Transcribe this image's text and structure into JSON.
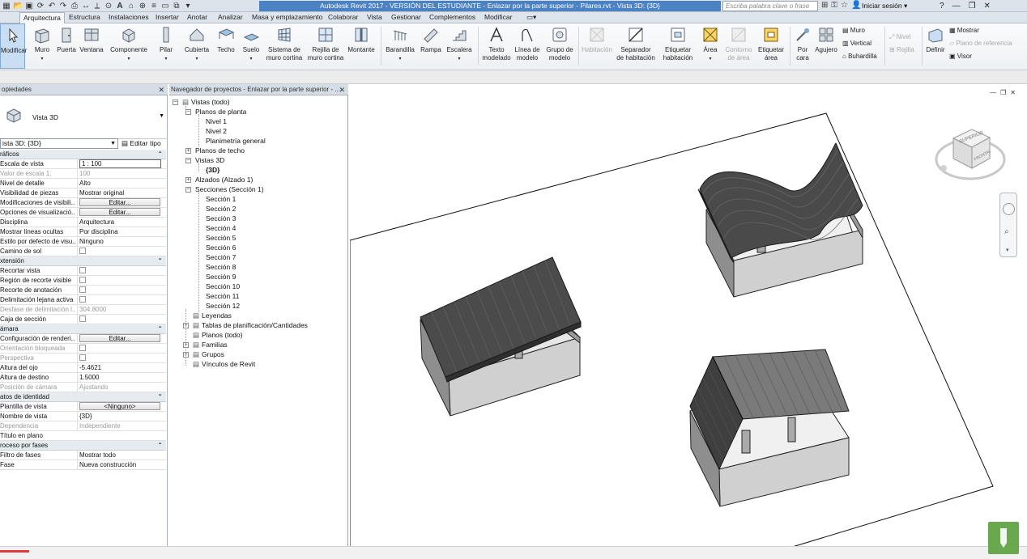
{
  "title_bar": {
    "window_title": "Autodesk Revit 2017 - VERSIÓN DEL ESTUDIANTE -    Enlazar por la parte superior - Pilares.rvt - Vista 3D: {3D}",
    "search_placeholder": "Escriba palabra clave o frase",
    "sign_in": "Iniciar sesión",
    "help": "?"
  },
  "tabs": [
    "Arquitectura",
    "Estructura",
    "Instalaciones",
    "Insertar",
    "Anotar",
    "Analizar",
    "Masa y emplazamiento",
    "Colaborar",
    "Vista",
    "Gestionar",
    "Complementos",
    "Modificar"
  ],
  "ribbon": {
    "modify": "Modificar",
    "muro": "Muro",
    "puerta": "Puerta",
    "ventana": "Ventana",
    "componente": "Componente",
    "pilar": "Pilar",
    "cubierta": "Cubierta",
    "techo": "Techo",
    "suelo": "Suelo",
    "sistema_muro_1": "Sistema de",
    "sistema_muro_2": "muro cortina",
    "rejilla_1": "Rejilla de",
    "rejilla_2": "muro cortina",
    "montante": "Montante",
    "barandilla": "Barandilla",
    "rampa": "Rampa",
    "escalera": "Escalera",
    "texto_1": "Texto",
    "texto_2": "modelado",
    "linea_1": "Línea de",
    "linea_2": "modelo",
    "grupo_1": "Grupo de",
    "grupo_2": "modelo",
    "habitacion": "Habitación",
    "separador_1": "Separador",
    "separador_2": "de habitación",
    "etiq_hab_1": "Etiquetar",
    "etiq_hab_2": "habitación",
    "area": "Área",
    "contorno_1": "Contorno",
    "contorno_2": "de área",
    "etiq_area_1": "Etiquetar",
    "etiq_area_2": "área",
    "por_cara_1": "Por",
    "por_cara_2": "cara",
    "agujero": "Agujero",
    "muro_s": "Muro",
    "vertical": "Vertical",
    "buhardilla": "Buhardilla",
    "nivel": "Nivel",
    "rejilla": "Rejilla",
    "definir": "Definir",
    "mostrar": "Mostrar",
    "plano_ref": "Plano de referencia",
    "visor": "Visor"
  },
  "properties": {
    "header": "opiedades",
    "type_name": "Vista 3D",
    "selector": "ista 3D: {3D}",
    "edit_type": "Editar tipo",
    "rows": [
      {
        "kind": "section",
        "label": "ráficos"
      },
      {
        "kind": "row",
        "label": "Escala de vista",
        "value": "1 : 100",
        "input": true
      },
      {
        "kind": "row",
        "label": "Valor de escala    1:",
        "value": "100",
        "disabled": true
      },
      {
        "kind": "row",
        "label": "Nivel de detalle",
        "value": "Alto"
      },
      {
        "kind": "row",
        "label": "Visibilidad de piezas",
        "value": "Mostrar original"
      },
      {
        "kind": "row",
        "label": "Modificaciones de visibili...",
        "value": "Editar...",
        "button": true
      },
      {
        "kind": "row",
        "label": "Opciones de visualizació...",
        "value": "Editar...",
        "button": true
      },
      {
        "kind": "row",
        "label": "Disciplina",
        "value": "Arquitectura"
      },
      {
        "kind": "row",
        "label": "Mostrar líneas ocultas",
        "value": "Por disciplina"
      },
      {
        "kind": "row",
        "label": "Estilo por defecto de visu...",
        "value": "Ninguno"
      },
      {
        "kind": "row",
        "label": "Camino de sol",
        "value": "",
        "checkbox": true
      },
      {
        "kind": "section",
        "label": "xtensión"
      },
      {
        "kind": "row",
        "label": "Recortar vista",
        "value": "",
        "checkbox": true
      },
      {
        "kind": "row",
        "label": "Región de recorte visible",
        "value": "",
        "checkbox": true
      },
      {
        "kind": "row",
        "label": "Recorte de anotación",
        "value": "",
        "checkbox": true
      },
      {
        "kind": "row",
        "label": "Delimitación lejana activa",
        "value": "",
        "checkbox": true
      },
      {
        "kind": "row",
        "label": "Desfase de delimitación l...",
        "value": "304.8000",
        "disabled": true
      },
      {
        "kind": "row",
        "label": "Caja de sección",
        "value": "",
        "checkbox": true
      },
      {
        "kind": "section",
        "label": "ámara"
      },
      {
        "kind": "row",
        "label": "Configuración de renderi...",
        "value": "Editar...",
        "button": true
      },
      {
        "kind": "row",
        "label": "Orientación bloqueada",
        "value": "",
        "checkbox": true,
        "disabled": true
      },
      {
        "kind": "row",
        "label": "Perspectiva",
        "value": "",
        "checkbox": true,
        "disabled": true
      },
      {
        "kind": "row",
        "label": "Altura del ojo",
        "value": "-5.4621"
      },
      {
        "kind": "row",
        "label": "Altura de destino",
        "value": "1.5000"
      },
      {
        "kind": "row",
        "label": "Posición de cámara",
        "value": "Ajustando",
        "disabled": true
      },
      {
        "kind": "section",
        "label": "atos de identidad"
      },
      {
        "kind": "row",
        "label": "Plantilla de vista",
        "value": "<Ninguno>",
        "button": true
      },
      {
        "kind": "row",
        "label": "Nombre de vista",
        "value": "{3D}"
      },
      {
        "kind": "row",
        "label": "Dependencia",
        "value": "Independiente",
        "disabled": true
      },
      {
        "kind": "row",
        "label": "Título en plano",
        "value": ""
      },
      {
        "kind": "section",
        "label": "roceso por fases"
      },
      {
        "kind": "row",
        "label": "Filtro de fases",
        "value": "Mostrar todo"
      },
      {
        "kind": "row",
        "label": "Fase",
        "value": "Nueva construcción"
      }
    ]
  },
  "browser": {
    "header": "Navegador de proyectos - Enlazar por la parte superior - ...",
    "vistas": "Vistas (todo)",
    "planos_planta": "Planos de planta",
    "nivel1": "Nivel 1",
    "nivel2": "Nivel 2",
    "planimetria": "Planimetría general",
    "planos_techo": "Planos de techo",
    "vistas3d": "Vistas 3D",
    "v3d": "{3D}",
    "alzados": "Alzados (Alzado 1)",
    "secciones": "Secciones (Sección 1)",
    "seccion_items": [
      "Sección 1",
      "Sección 2",
      "Sección 3",
      "Sección 4",
      "Sección 5",
      "Sección 6",
      "Sección 7",
      "Sección 8",
      "Sección 9",
      "Sección 10",
      "Sección 11",
      "Sección 12"
    ],
    "leyendas": "Leyendas",
    "tablas": "Tablas de planificación/Cantidades",
    "planos": "Planos (todo)",
    "familias": "Familias",
    "grupos": "Grupos",
    "vinculos": "Vínculos de Revit"
  },
  "viewcube": {
    "top": "SUPERIOR",
    "front": "FRONTAL"
  },
  "colors": {
    "accent": "#4b82c4",
    "roof": "#4d4d4d",
    "wall_light": "#cfcfcf",
    "wall_dark": "#8a8a8a"
  }
}
